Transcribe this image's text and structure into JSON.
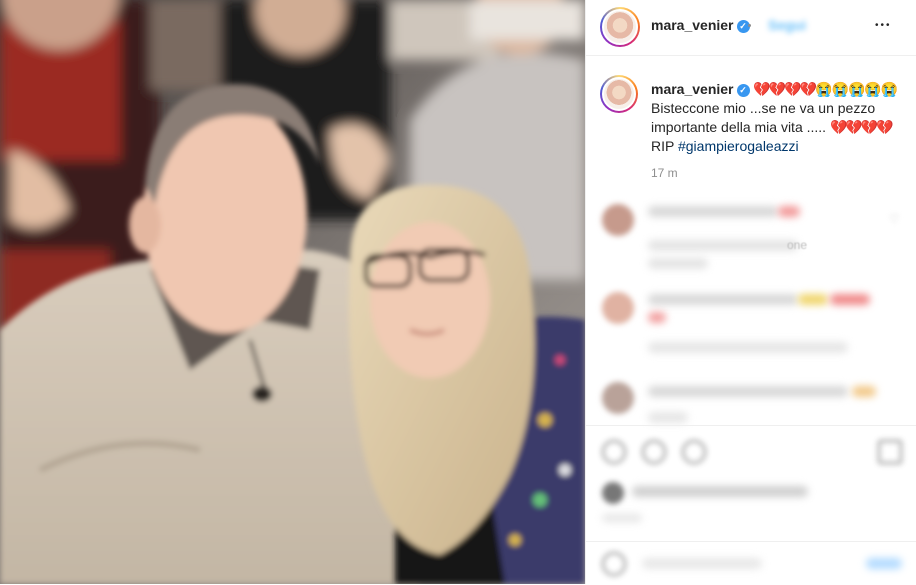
{
  "post": {
    "username": "mara_venier",
    "verified_mark": "✓",
    "follow_label": "Segui",
    "more_glyph": "•••",
    "caption": {
      "hearts_a": "💔💔💔💔",
      "crying": "😭😭😭😭😭",
      "text_line": "Bisteccone mio ...se ne va un pezzo importante della mia vita .....",
      "hearts_b": "💔💔💔💔",
      "rip": "RIP",
      "hashtag": "#giampierogaleazzi"
    },
    "time_ago": "17 m"
  },
  "comments": [
    {
      "fragment": ""
    },
    {
      "fragment": "one"
    },
    {
      "fragment": ""
    }
  ],
  "icons": {
    "verified": "verified-badge-icon",
    "more": "more-options-icon",
    "like": "heart-icon",
    "comment": "comment-icon",
    "share": "share-icon",
    "save": "bookmark-icon",
    "emoji": "emoji-icon"
  },
  "colors": {
    "accent": "#0095f6",
    "verified": "#3897f0",
    "hashtag": "#00376b",
    "heart": "#d11f2f"
  }
}
